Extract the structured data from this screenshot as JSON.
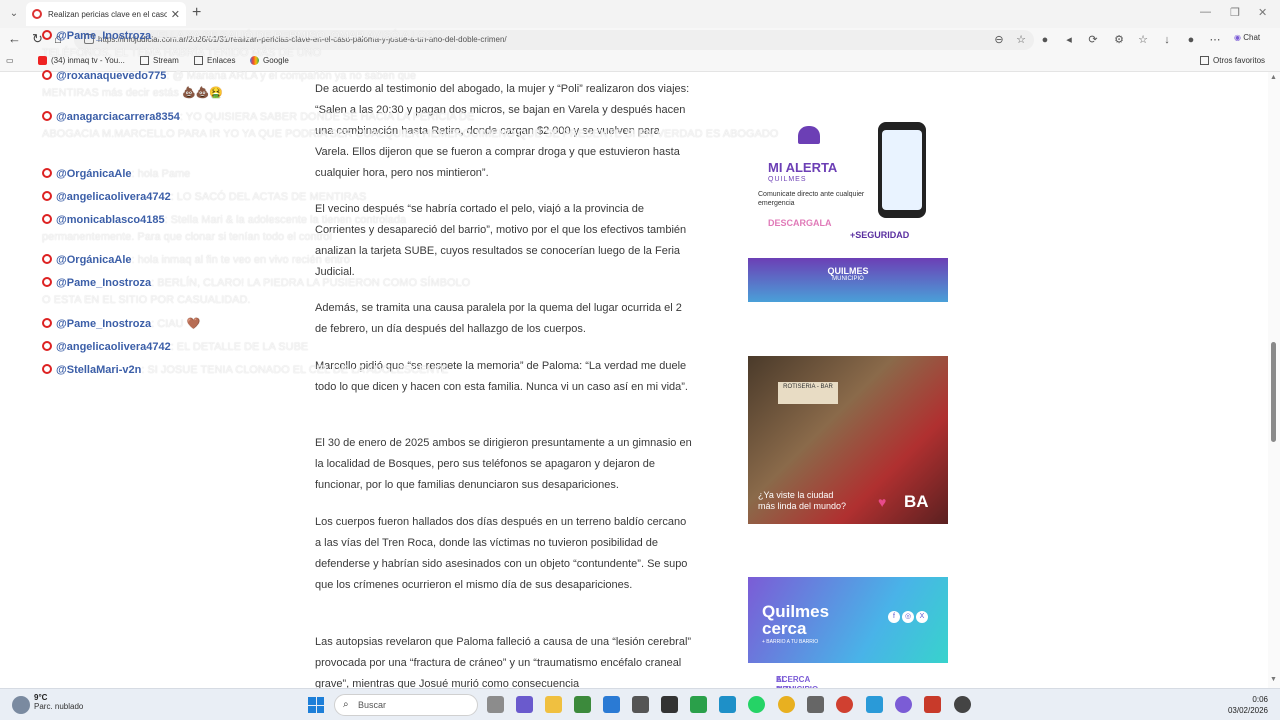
{
  "browser": {
    "tab_title": "Realizan pericias clave en el caso P",
    "url": "https://infojudicial.com.ar/2026/01/31/realizan-pericias-clave-en-el-caso-paloma-y-josue-a-un-ano-del-doble-crimen/",
    "chat_label": "Chat",
    "bookmarks": [
      {
        "label": "(34) inmaq tv - You...",
        "icon": "youtube-icon"
      },
      {
        "label": "Stream",
        "icon": "folder-icon"
      },
      {
        "label": "Enlaces",
        "icon": "folder-icon"
      },
      {
        "label": "Google",
        "icon": "google-icon"
      }
    ],
    "other_favorites": "Otros favoritos"
  },
  "article": {
    "paragraphs": [
      "De acuerdo al testimonio del abogado, la mujer y “Poli” realizaron dos viajes: “Salen a las 20:30 y pagan dos micros, se bajan en Varela y después hacen una combinación hasta Retiro, donde cargan $2.000 y se vuelven para Varela. Ellos dijeron que se fueron a comprar droga y que estuvieron hasta cualquier hora, pero nos mintieron”.",
      "El vecino después “se habría cortado el pelo, viajó a la provincia de Corrientes y desapareció del barrio”, motivo por el que los efectivos también analizan la tarjeta SUBE, cuyos resultados se conocerían luego de la Feria Judicial.",
      "Además, se tramita una causa paralela por la quema del lugar ocurrida el 2 de febrero, un día después del hallazgo de los cuerpos.",
      "Marcello pidió que “se respete la memoria” de Paloma: “La verdad me duele todo lo que dicen y hacen con esta familia. Nunca vi un caso así en mi vida”.",
      "El 30 de enero de 2025 ambos se dirigieron presuntamente a un gimnasio en la localidad de Bosques, pero sus teléfonos se apagaron y dejaron de funcionar, por lo que familias denunciaron sus desapariciones.",
      "Los cuerpos fueron hallados dos días después en un terreno baldío cercano a las vías del Tren Roca, donde las víctimas no tuvieron posibilidad de defenderse y habrían sido asesinados con un objeto “contundente”. Se supo que los crímenes ocurrieron el mismo día de sus desapariciones.",
      "Las autopsias revelaron que Paloma falleció a causa de una “lesión cerebral” provocada por una “fractura de cráneo” y un “traumatismo encéfalo craneal grave”, mientras que Josué murió como consecuencia"
    ]
  },
  "ads": {
    "ad1": {
      "brand": "MI ALERTA",
      "sub": "QUILMES",
      "desc": "Comunicate directo ante cualquier emergencia",
      "download": "DESCARGALA",
      "security": "+SEGURIDAD",
      "footer": "QUILMES",
      "footer_sub": "MUNICIPIO"
    },
    "ad2": {
      "sign": "ROTISERIA - BAR",
      "text_line1": "¿Ya viste la ciudad",
      "text_line2": "más linda del mundo?",
      "logo": "BA"
    },
    "ad3": {
      "brand_line1": "Quilmes",
      "brand_line2": "cerca",
      "sub": "+ BARRIO A TU BARRIO",
      "bottom_line1": "EL MUNICIPIO DE QUILMES SE",
      "bottom_line2": "ACERCA A TU CASA"
    }
  },
  "chat": [
    {
      "user": "@Pame_Inostroza",
      "text": ": ELLA YA SE SALIÓ DE PERMISO, OMAR AVISÓ A LOS",
      "text2": "TELÉFONOS, EL TEMA HABRÍA TENIDO MÁS DE UNO"
    },
    {
      "user": "@roxanaquevedo775",
      "text": ": @ Mariana ARLA y el compañón ya no saben que",
      "text2": "MENTIRAS más decir estás 💩💩🤮"
    },
    {
      "user": "@anagarciacarrera8354",
      "text": ": YO QUISIERA SABER DONDE SE HACIA LA PERICIA DE",
      "text2": "ABOGACIA M.MARCELLO PARA IR YO YA QUE PODRIA SER CUALQUIER HEMERGUIMENO QUE SE PRESENTE SI EN VERDAD ES ABOGADO"
    },
    {
      "user": "@OrgánicaAle",
      "text": ": hola Pame",
      "text2": ""
    },
    {
      "user": "@angelicaolivera4742",
      "text": ": LO SACÓ DEL ACTAS DE MENTIRAS",
      "text2": ""
    },
    {
      "user": "@monicablasco4185",
      "text": ": Stella Mari & la adolescente la tienen controlada",
      "text2": "permanentemente. Para que clonar si tenían todo el control"
    },
    {
      "user": "@OrgánicaAle",
      "text": ": hola inmaq al fin te veo en vivo recién entro",
      "text2": ""
    },
    {
      "user": "@Pame_Inostroza",
      "text": ": BERLÍN, CLARO! LA PIEDRA LA PUSIERON COMO SÍMBOLO",
      "text2": "O ESTA EN EL SITIO POR CASUALIDAD."
    },
    {
      "user": "@Pame_Inostroza",
      "text": ": CIAU 🤎",
      "text2": ""
    },
    {
      "user": "@angelicaolivera4742",
      "text": ": EL DETALLE DE LA SUBE",
      "text2": ""
    },
    {
      "user": "@StellaMari-v2n",
      "text": ": SI JOSUE TENIA CLONADO EL CEL DE LA ADOLESCENTE",
      "text2": ""
    }
  ],
  "taskbar": {
    "temperature": "9°C",
    "weather_desc": "Parc. nublado",
    "search_placeholder": "Buscar",
    "time": "0:06",
    "date": "03/02/2026",
    "weather_badge": "1"
  }
}
